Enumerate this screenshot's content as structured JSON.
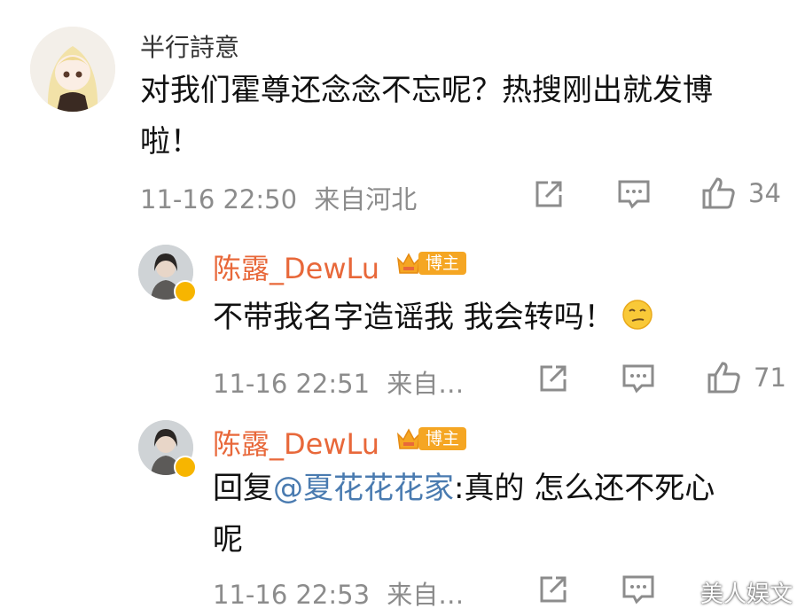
{
  "comments": [
    {
      "username": "半行詩意",
      "content_lines": [
        "对我们霍尊还念念不忘呢？热搜刚出就发博",
        "啦！"
      ],
      "time": "11-16 22:50",
      "location": "来自河北",
      "likes": "34"
    },
    {
      "username": "陈露_DewLu",
      "badge": "博主",
      "content": "不带我名字造谣我 我会转吗！",
      "emoji": "smirk-emoji",
      "time": "11-16 22:51",
      "location": "来自…",
      "likes": "71"
    },
    {
      "username": "陈露_DewLu",
      "badge": "博主",
      "reply_prefix": "回复",
      "mention": "@夏花花花家",
      "reply_text": ":真的 怎么还不死心",
      "reply_line2": "呢",
      "time": "11-16 22:53",
      "location": "来自…"
    }
  ],
  "watermark": "美人娱文",
  "colors": {
    "blogger_name": "#e8683a",
    "badge_bg": "#f5a623",
    "mention": "#4a7bb0",
    "meta": "#8c8c8c"
  }
}
